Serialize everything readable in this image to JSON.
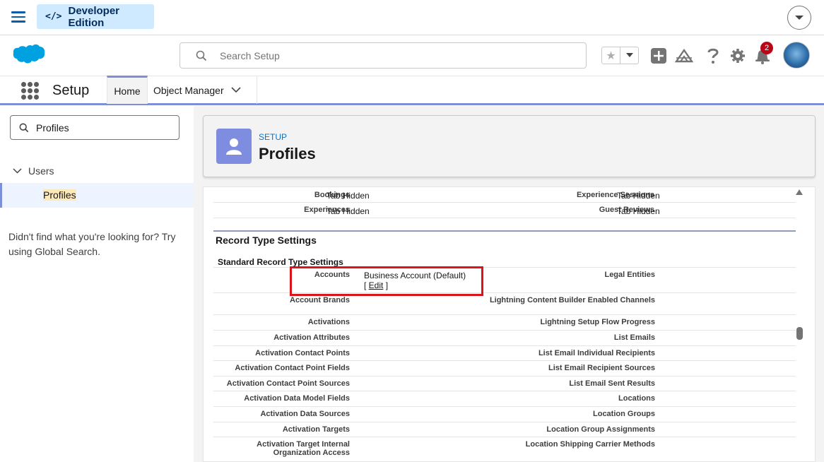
{
  "devbar": {
    "edition_code": "</>",
    "edition_label": "Developer Edition"
  },
  "header": {
    "search_placeholder": "Search Setup",
    "notification_count": "2"
  },
  "nav": {
    "app_name": "Setup",
    "tabs": [
      {
        "label": "Home"
      },
      {
        "label": "Object Manager"
      }
    ]
  },
  "sidebar": {
    "quick_find_value": "Profiles",
    "tree_parent": "Users",
    "tree_child": "Profiles",
    "not_found_text": "Didn't find what you're looking for? Try using Global Search."
  },
  "page": {
    "eyebrow": "SETUP",
    "title": "Profiles"
  },
  "tab_settings": [
    {
      "label": "Bookings",
      "value": "Tab Hidden",
      "label2": "Experience Sessions",
      "value2": "Tab Hidden"
    },
    {
      "label": "Experiences",
      "value": "Tab Hidden",
      "label2": "Guest Reviews",
      "value2": "Tab Hidden"
    }
  ],
  "record_type": {
    "section_title": "Record Type Settings",
    "subsection_title": "Standard Record Type Settings",
    "rows": [
      {
        "left": "Accounts",
        "value": "Business Account (Default)",
        "edit_open": "[ ",
        "edit_label": "Edit",
        "edit_close": " ]",
        "right": "Legal Entities"
      },
      {
        "left": "Account Brands",
        "right": "Lightning Content Builder Enabled Channels"
      },
      {
        "left": "Activations",
        "right": "Lightning Setup Flow Progress"
      },
      {
        "left": "Activation Attributes",
        "right": "List Emails"
      },
      {
        "left": "Activation Contact Points",
        "right": "List Email Individual Recipients"
      },
      {
        "left": "Activation Contact Point Fields",
        "right": "List Email Recipient Sources"
      },
      {
        "left": "Activation Contact Point Sources",
        "right": "List Email Sent Results"
      },
      {
        "left": "Activation Data Model Fields",
        "right": "Locations"
      },
      {
        "left": "Activation Data Sources",
        "right": "Location Groups"
      },
      {
        "left": "Activation Targets",
        "right": "Location Group Assignments"
      },
      {
        "left": "Activation Target Internal Organization Access",
        "right": "Location Shipping Carrier Methods"
      }
    ]
  },
  "colors": {
    "accent": "#7d8fd9",
    "brand": "#00a1e0",
    "highlight": "#d9141b",
    "link": "#0176d3"
  }
}
